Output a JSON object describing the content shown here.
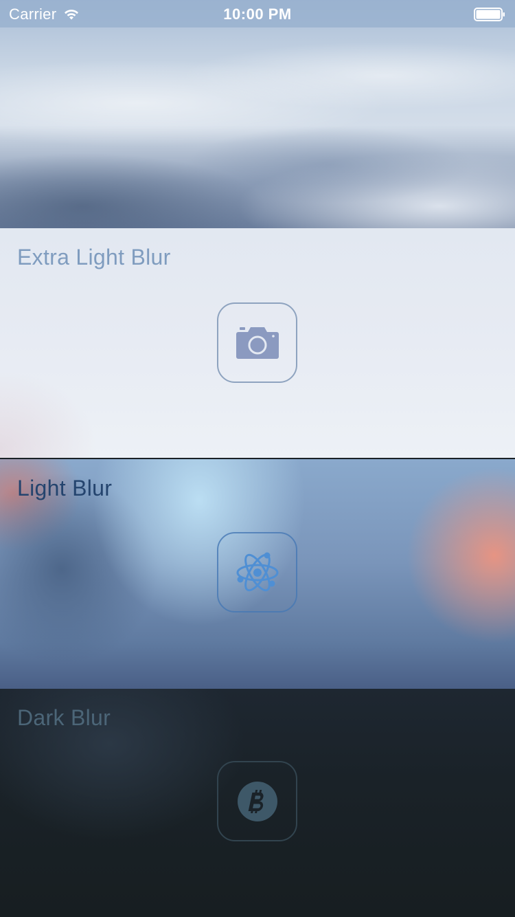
{
  "status_bar": {
    "carrier": "Carrier",
    "time": "10:00 PM",
    "wifi_icon": "wifi-icon",
    "battery_icon": "battery-full-icon"
  },
  "header": {
    "image": "sky-clouds-photo"
  },
  "panels": [
    {
      "title": "Extra Light Blur",
      "icon": "camera-icon",
      "style": "extra-light",
      "title_color": "#7f9cbf",
      "icon_color": "#8b9ac0"
    },
    {
      "title": "Light Blur",
      "icon": "atom-icon",
      "style": "light",
      "title_color": "#24446e",
      "icon_color": "#4f8fd4"
    },
    {
      "title": "Dark Blur",
      "icon": "bitcoin-icon",
      "style": "dark",
      "title_color": "#4c6678",
      "icon_color": "#3e5868"
    }
  ]
}
